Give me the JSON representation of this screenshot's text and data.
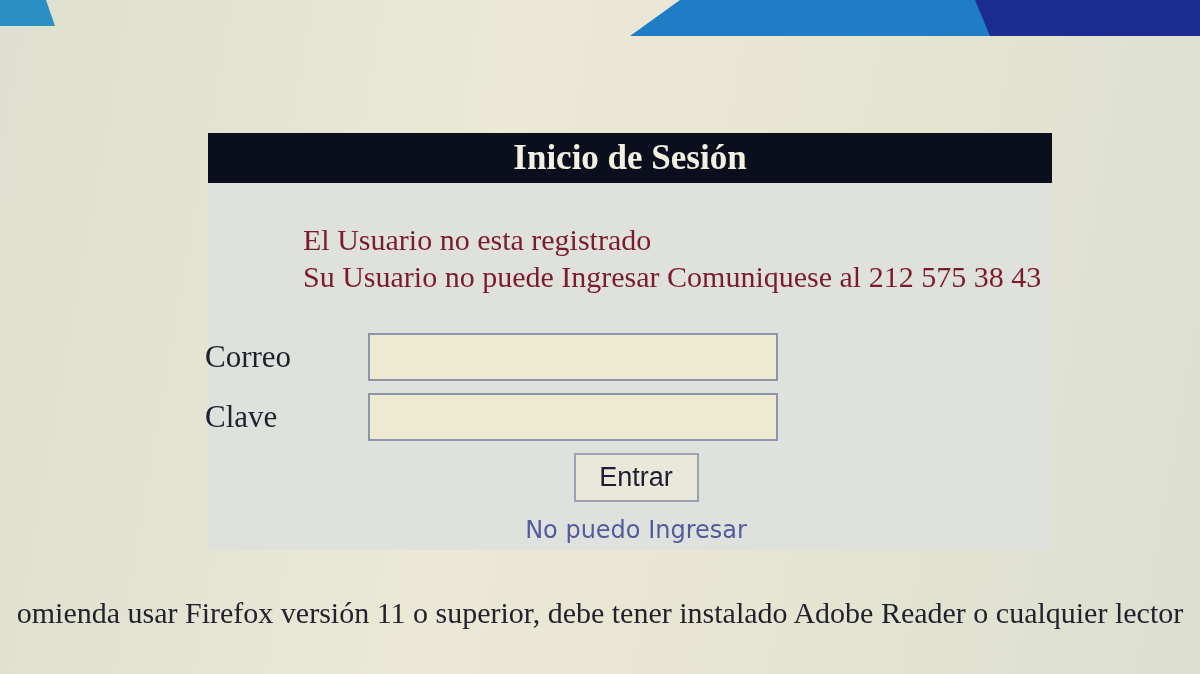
{
  "login_panel": {
    "title": "Inicio de Sesión",
    "messages": [
      "El Usuario no esta registrado",
      "Su Usuario no puede Ingresar Comuniquese al 212 575 38 43"
    ],
    "fields": [
      {
        "label": "Correo"
      },
      {
        "label": "Clave"
      }
    ],
    "submit_button": "Entrar",
    "help_link": "No puedo Ingresar"
  },
  "footer_note": "omienda usar Firefox versión 11 o superior, debe tener instalado Adobe Reader o cualquier lector"
}
